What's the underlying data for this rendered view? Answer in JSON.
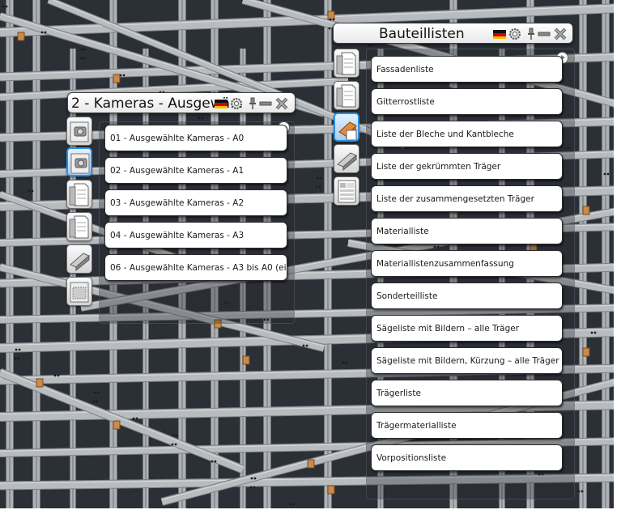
{
  "camera_panel": {
    "title": "2 - Kameras - Ausgewä...",
    "items": [
      "01 - Ausgewählte Kameras - A0",
      "02 - Ausgewählte Kameras - A1",
      "03 - Ausgewählte Kameras - A2",
      "04 - Ausgewählte Kameras - A3",
      "06 - Ausgewählte Kameras - A3 bis A0 (ei..."
    ],
    "side_icons": [
      "camera-icon",
      "camera-selected-icon",
      "drawing-icon",
      "drawing-stack-icon",
      "steel-section-icon",
      "section-plan-icon"
    ]
  },
  "parts_panel": {
    "title": "Bauteillisten",
    "items": [
      "Fassadenliste",
      "Gitterrostliste",
      "Liste der Bleche und Kantbleche",
      "Liste der gekrümmten Träger",
      "Liste der zusammengesetzten Träger",
      "Materialliste",
      "Materiallistenzusammenfassung",
      "Sonderteilliste",
      "Sägeliste mit Bildern – alle Träger",
      "Sägeliste mit Bildern, Kürzung – alle Träger",
      "Trägerliste",
      "Trägermaterialliste",
      "Vorpositionsliste"
    ],
    "side_icons": [
      "report-sheet-icon",
      "report-sheet-alt-icon",
      "plate-list-selected-icon",
      "curved-beam-list-icon",
      "assembly-table-icon"
    ]
  },
  "toolbar_icons": [
    "german-flag-icon",
    "settings-icon",
    "pin-icon",
    "minimize-icon",
    "close-icon"
  ],
  "colors": {
    "viewport_bg": "#2b3037",
    "steel": "#b9bcbf",
    "connection_plate": "#c98a4b",
    "selection_blue": "#2e8fe0"
  }
}
